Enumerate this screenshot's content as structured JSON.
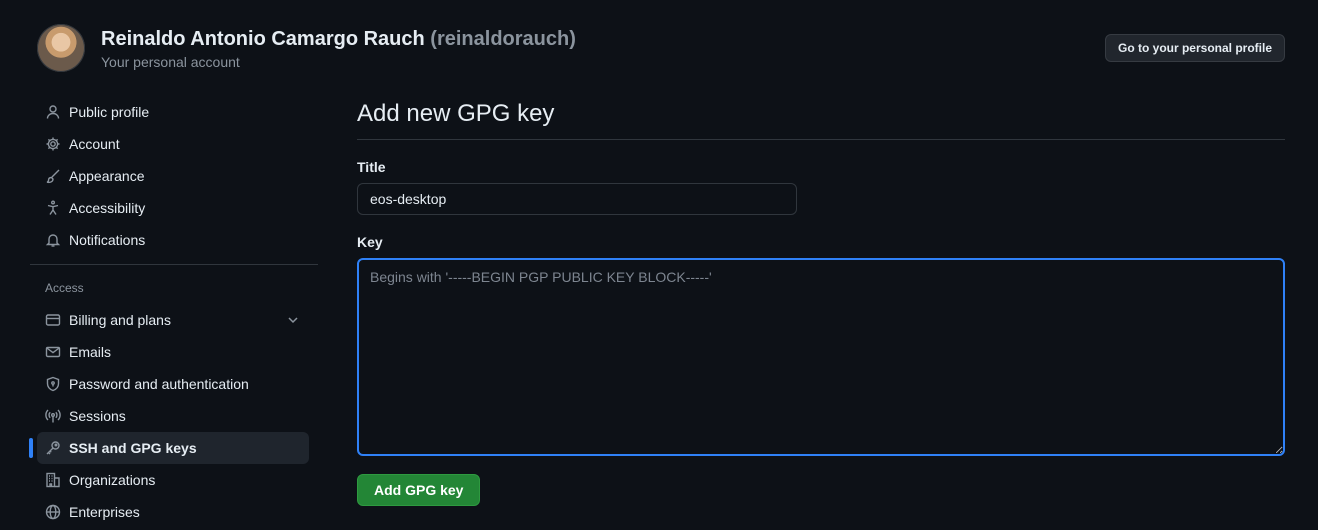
{
  "header": {
    "name": "Reinaldo Antonio Camargo Rauch",
    "handle": "(reinaldorauch)",
    "subtitle": "Your personal account",
    "profile_button": "Go to your personal profile"
  },
  "sidebar": {
    "items": [
      {
        "label": "Public profile",
        "icon": "person-icon"
      },
      {
        "label": "Account",
        "icon": "gear-icon"
      },
      {
        "label": "Appearance",
        "icon": "paintbrush-icon"
      },
      {
        "label": "Accessibility",
        "icon": "accessibility-icon"
      },
      {
        "label": "Notifications",
        "icon": "bell-icon"
      }
    ],
    "access_label": "Access",
    "access_items": [
      {
        "label": "Billing and plans",
        "icon": "credit-card-icon",
        "expandable": true
      },
      {
        "label": "Emails",
        "icon": "mail-icon"
      },
      {
        "label": "Password and authentication",
        "icon": "shield-lock-icon"
      },
      {
        "label": "Sessions",
        "icon": "broadcast-icon"
      },
      {
        "label": "SSH and GPG keys",
        "icon": "key-icon",
        "active": true
      },
      {
        "label": "Organizations",
        "icon": "organization-icon"
      },
      {
        "label": "Enterprises",
        "icon": "globe-icon"
      }
    ]
  },
  "main": {
    "title": "Add new GPG key",
    "title_label": "Title",
    "title_value": "eos-desktop",
    "key_label": "Key",
    "key_placeholder": "Begins with '-----BEGIN PGP PUBLIC KEY BLOCK-----'",
    "key_value": "",
    "submit_label": "Add GPG key"
  },
  "colors": {
    "background": "#0d1117",
    "accent": "#2f81f7",
    "primary_button": "#238636",
    "muted_text": "#8b949e"
  }
}
